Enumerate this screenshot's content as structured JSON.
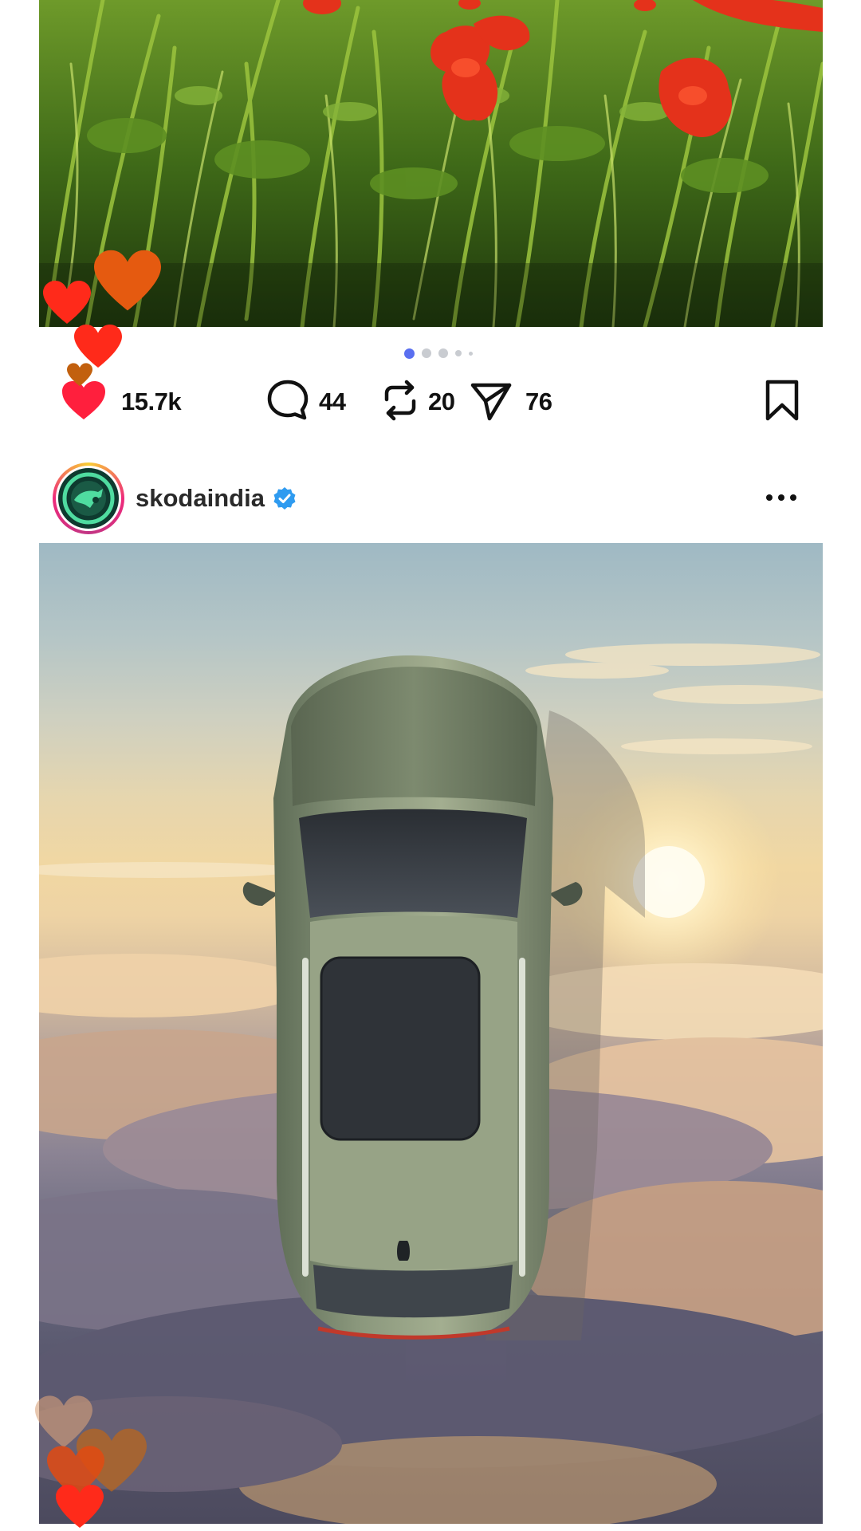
{
  "post1": {
    "media_alt_visible": false,
    "carousel": {
      "total": 5,
      "active": 0
    },
    "actions": {
      "likes": "15.7k",
      "comments": "44",
      "reposts": "20",
      "shares": "76"
    },
    "icons": {
      "like": "heart-filled-icon",
      "comment": "speech-bubble-icon",
      "repost": "repost-arrows-icon",
      "share": "paper-plane-icon",
      "save": "bookmark-icon"
    }
  },
  "post2": {
    "username": "skodaindia",
    "verified": true,
    "icons": {
      "avatar": "skoda-logo",
      "verified": "verified-badge-icon",
      "more": "more-dots-icon"
    }
  },
  "colors": {
    "like": "#ff1f3d",
    "verified": "#2f9bf0",
    "active_dot": "#5a6ff0",
    "inactive_dot": "#c9ccd1"
  }
}
